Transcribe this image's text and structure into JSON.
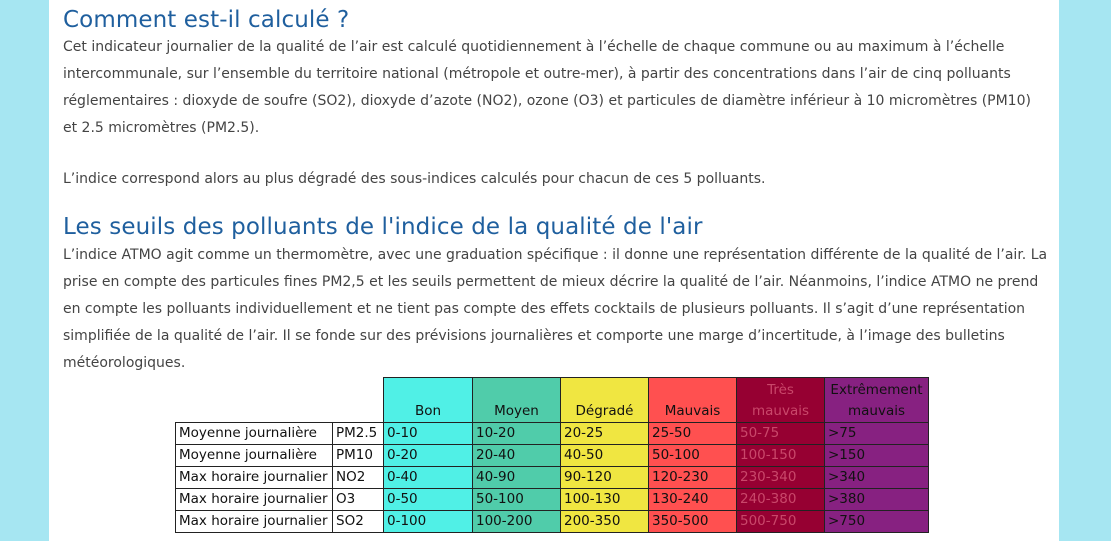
{
  "section1": {
    "title": "Comment est-il calculé ?",
    "paragraph1": "Cet indicateur journalier de la qualité de l’air est calculé quotidiennement à l’échelle de chaque commune ou au maximum à l’échelle intercommunale, sur l’ensemble du territoire national (métropole et outre-mer), à partir des concentrations dans l’air de cinq polluants réglementaires : dioxyde de soufre (SO2), dioxyde d’azote (NO2), ozone (O3) et particules de diamètre inférieur à 10 micromètres (PM10) et 2.5 micromètres (PM2.5).",
    "paragraph2": "L’indice correspond alors au plus dégradé des sous-indices calculés pour chacun de ces 5 polluants."
  },
  "section2": {
    "title": "Les seuils des polluants de l'indice de la qualité de l'air",
    "paragraph": "L’indice ATMO agit comme un thermomètre, avec une graduation spécifique : il donne une représentation différente de la qualité de l’air. La prise en compte des particules fines PM2,5 et les seuils permettent de mieux décrire la qualité de l’air. Néanmoins, l’indice ATMO ne prend en compte les polluants individuellement et ne tient pas compte des effets cocktails de plusieurs polluants. Il s’agit d’une représentation simplifiée de la qualité de l’air. Il se fonde sur des prévisions journalières et comporte une marge d’incertitude, à l’image des bulletins météorologiques."
  },
  "table": {
    "headers": [
      "Bon",
      "Moyen",
      "Dégradé",
      "Mauvais",
      "Très mauvais",
      "Extrêmement mauvais"
    ],
    "header_colors": [
      "#50f0e6",
      "#50ccaa",
      "#f0e641",
      "#ff5050",
      "#960032",
      "#872181"
    ],
    "rows": [
      {
        "label": "Moyenne journalière",
        "pollutant": "PM2.5",
        "values": [
          "0-10",
          "10-20",
          "20-25",
          "25-50",
          "50-75",
          ">75"
        ]
      },
      {
        "label": "Moyenne journalière",
        "pollutant": "PM10",
        "values": [
          "0-20",
          "20-40",
          "40-50",
          "50-100",
          "100-150",
          ">150"
        ]
      },
      {
        "label": "Max horaire journalier",
        "pollutant": "NO2",
        "values": [
          "0-40",
          "40-90",
          "90-120",
          "120-230",
          "230-340",
          ">340"
        ]
      },
      {
        "label": "Max horaire journalier",
        "pollutant": "O3",
        "values": [
          "0-50",
          "50-100",
          "100-130",
          "130-240",
          "240-380",
          ">380"
        ]
      },
      {
        "label": "Max horaire journalier",
        "pollutant": "SO2",
        "values": [
          "0-100",
          "100-200",
          "200-350",
          "350-500",
          "500-750",
          ">750"
        ]
      }
    ]
  }
}
